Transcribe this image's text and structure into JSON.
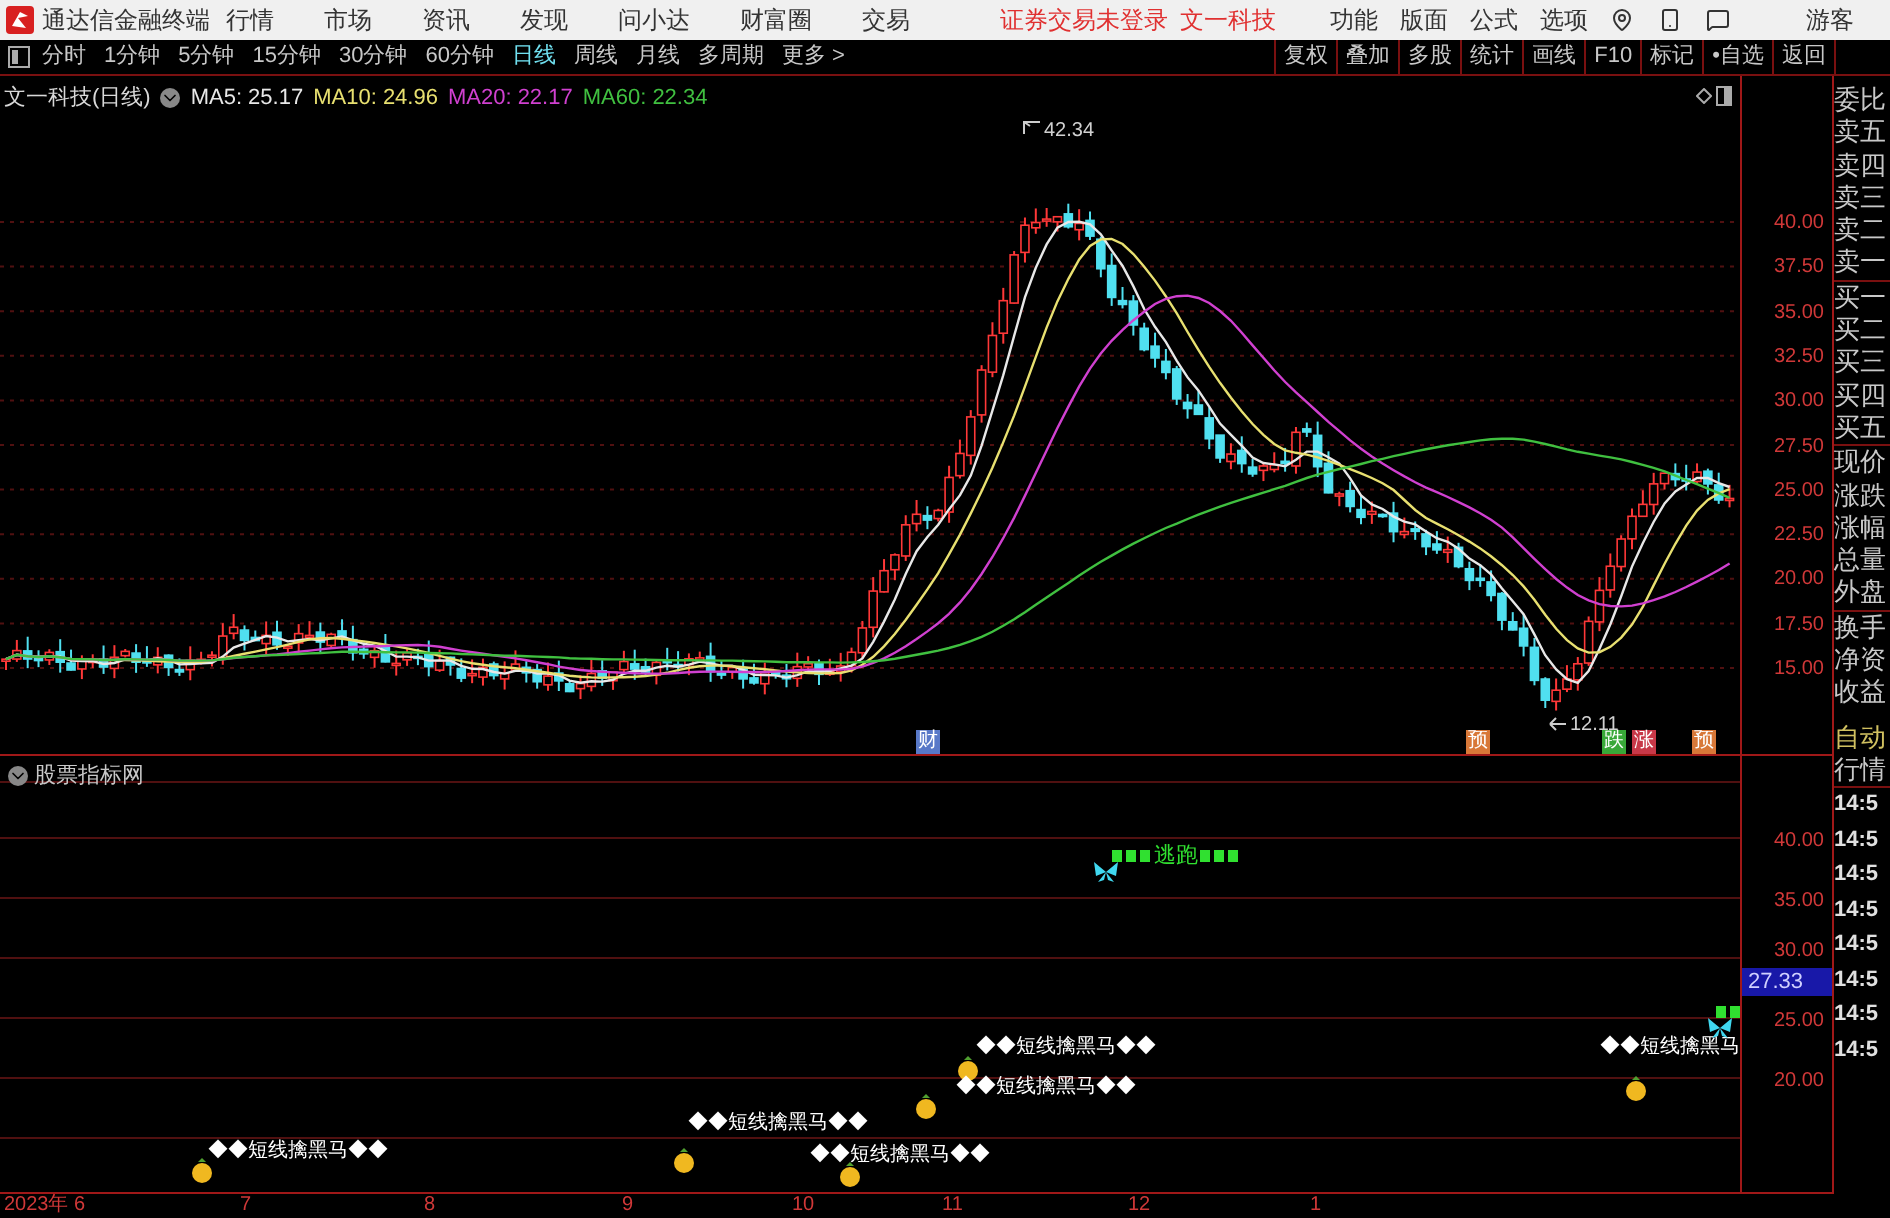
{
  "title_bar": {
    "app_title": "通达信金融终端",
    "menu": [
      "行情",
      "市场",
      "资讯",
      "发现",
      "问小达",
      "财富圈",
      "交易"
    ],
    "notice": "证券交易未登录",
    "stock": "文一科技",
    "right_menu": [
      "功能",
      "版面",
      "公式",
      "选项"
    ],
    "user": "游客"
  },
  "periods": [
    {
      "label": "分时",
      "selected": false
    },
    {
      "label": "1分钟",
      "selected": false
    },
    {
      "label": "5分钟",
      "selected": false
    },
    {
      "label": "15分钟",
      "selected": false
    },
    {
      "label": "30分钟",
      "selected": false
    },
    {
      "label": "60分钟",
      "selected": false
    },
    {
      "label": "日线",
      "selected": true
    },
    {
      "label": "周线",
      "selected": false
    },
    {
      "label": "月线",
      "selected": false
    },
    {
      "label": "多周期",
      "selected": false
    },
    {
      "label": "更多 >",
      "selected": false
    }
  ],
  "tools": [
    "复权",
    "叠加",
    "多股",
    "统计",
    "画线",
    "F10",
    "标记",
    "•自选",
    "返回"
  ],
  "chart": {
    "title": "文一科技(日线)",
    "ma": [
      {
        "label": "MA5: 25.17",
        "color": "#e8e8e8"
      },
      {
        "label": "MA10: 24.96",
        "color": "#e8e070"
      },
      {
        "label": "MA20: 22.17",
        "color": "#d040d0"
      },
      {
        "label": "MA60: 22.34",
        "color": "#40c040"
      }
    ],
    "high_label": "42.34",
    "low_label": "12.11",
    "y_labels": [
      "40.00",
      "37.50",
      "35.00",
      "32.50",
      "30.00",
      "27.50",
      "25.00",
      "22.50",
      "20.00",
      "17.50",
      "15.00"
    ],
    "event_tags": [
      {
        "text": "财",
        "color": "#5878c8"
      },
      {
        "text": "预",
        "color": "#d87838"
      },
      {
        "text": "跌",
        "color": "#38a838"
      },
      {
        "text": "涨",
        "color": "#c83848"
      },
      {
        "text": "预",
        "color": "#d87838"
      }
    ]
  },
  "indicator": {
    "title": "股票指标网",
    "y_labels": [
      "40.00",
      "35.00",
      "30.00",
      "25.00",
      "20.00"
    ],
    "current_value": "27.33",
    "signals": [
      {
        "kind": "buy",
        "text": "◆◆短线擒黑马◆◆"
      },
      {
        "kind": "buy",
        "text": "◆◆短线擒黑马◆◆"
      },
      {
        "kind": "buy",
        "text": "◆◆短线擒黑马◆◆"
      },
      {
        "kind": "buy",
        "text": "◆◆短线擒黑马◆◆"
      },
      {
        "kind": "buy",
        "text": "◆◆短线擒黑马◆◆"
      },
      {
        "kind": "escape",
        "text": "逃跑"
      },
      {
        "kind": "buy",
        "text": "◆◆短线擒黑马"
      },
      {
        "kind": "escape-mark"
      }
    ]
  },
  "x_axis": [
    "2023年 6",
    "7",
    "8",
    "9",
    "10",
    "11",
    "12",
    "1"
  ],
  "quote_panel": {
    "labels": [
      "委比",
      "卖五",
      "卖四",
      "卖三",
      "卖二",
      "卖一",
      "买一",
      "买二",
      "买三",
      "买四",
      "买五",
      "现价",
      "涨跌",
      "涨幅",
      "总量",
      "外盘",
      "换手",
      "净资",
      "收益"
    ],
    "auto": "自动",
    "market": "行情",
    "times": [
      "14:5",
      "14:5",
      "14:5",
      "14:5",
      "14:5",
      "14:5",
      "14:5",
      "14:5"
    ]
  }
}
